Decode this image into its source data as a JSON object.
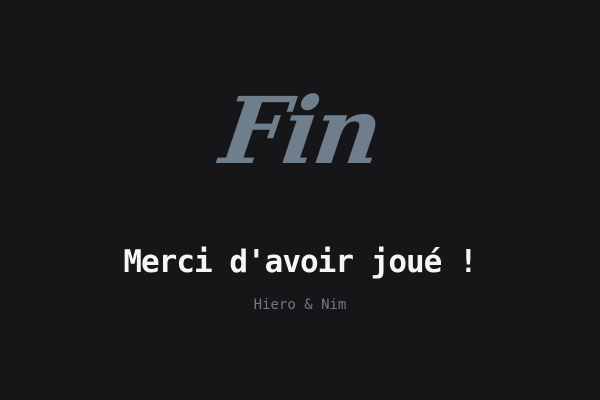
{
  "end_screen": {
    "title": "Fin",
    "message": "Merci d'avoir joué !",
    "credits": "Hiero & Nim"
  },
  "colors": {
    "background": "#161618",
    "title": "#6e7e8c",
    "message": "#f5f5f5",
    "credits": "#6c7a88"
  }
}
